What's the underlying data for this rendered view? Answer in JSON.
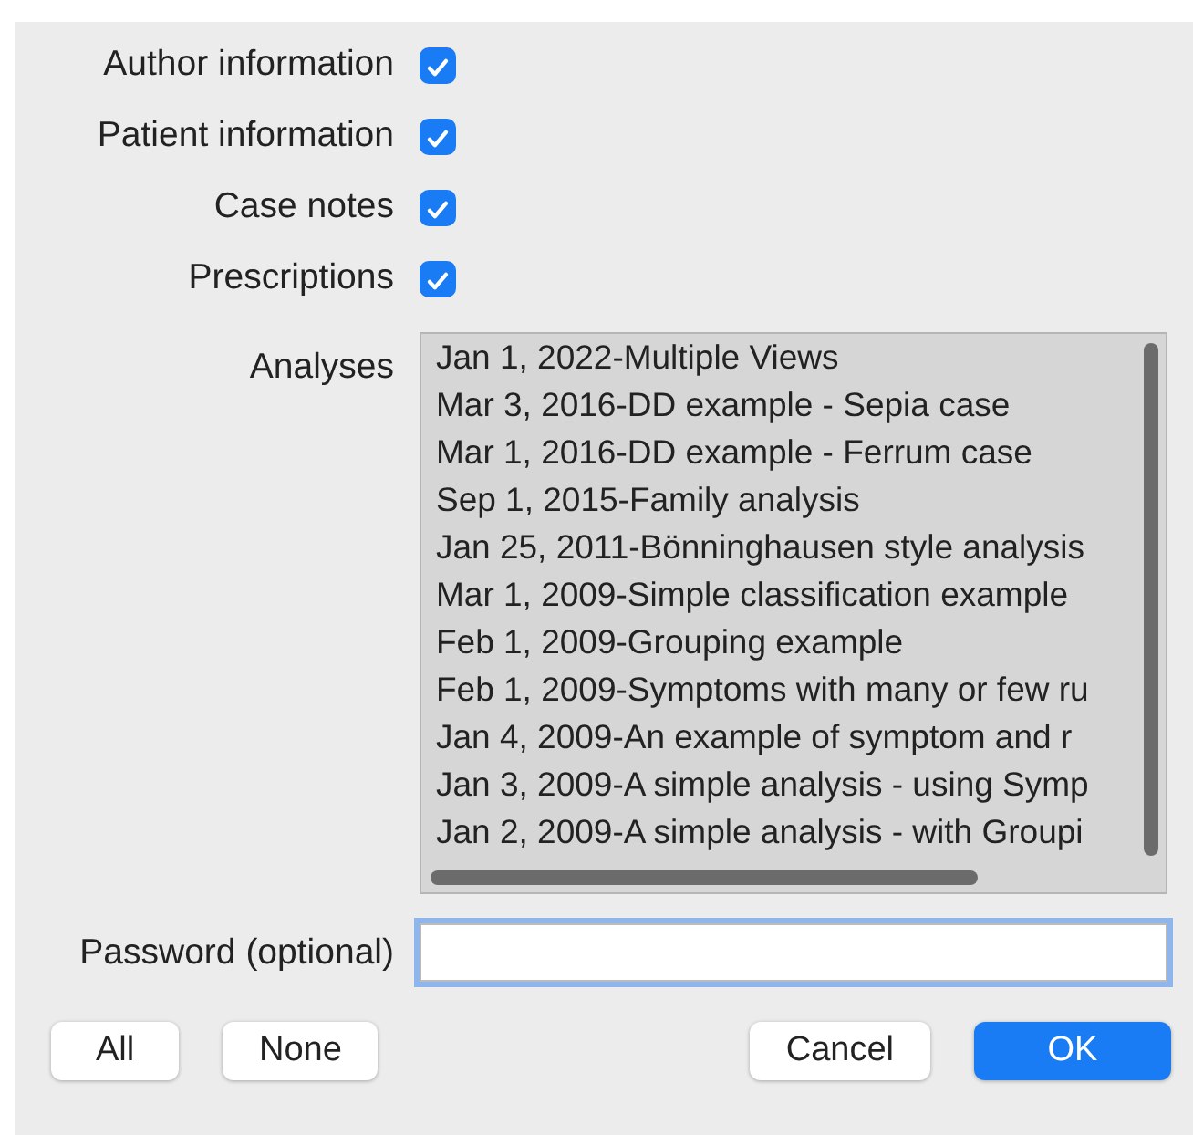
{
  "options": [
    {
      "label": "Author information",
      "checked": true
    },
    {
      "label": "Patient information",
      "checked": true
    },
    {
      "label": "Case notes",
      "checked": true
    },
    {
      "label": "Prescriptions",
      "checked": true
    }
  ],
  "analyses": {
    "label": "Analyses",
    "items": [
      {
        "text": "Jan 1, 2022-Multiple Views",
        "selected": true
      },
      {
        "text": "Mar 3, 2016-DD example - Sepia case",
        "selected": true
      },
      {
        "text": "Mar 1, 2016-DD example - Ferrum case",
        "selected": true
      },
      {
        "text": "Sep 1, 2015-Family analysis",
        "selected": true
      },
      {
        "text": "Jan 25, 2011-Bönninghausen style analysis",
        "selected": true
      },
      {
        "text": "Mar 1, 2009-Simple classification example",
        "selected": true
      },
      {
        "text": "Feb 1, 2009-Grouping example",
        "selected": true
      },
      {
        "text": "Feb 1, 2009-Symptoms with many or few ru",
        "selected": true
      },
      {
        "text": "Jan 4, 2009-An example of symptom and r",
        "selected": true
      },
      {
        "text": "Jan 3, 2009-A simple analysis - using Symp",
        "selected": true
      },
      {
        "text": "Jan 2, 2009-A simple analysis - with Groupi",
        "selected": true
      }
    ]
  },
  "password": {
    "label": "Password (optional)",
    "focused": true
  },
  "left_buttons": [
    {
      "label": "All",
      "kind": "plain"
    },
    {
      "label": "None",
      "kind": "plain"
    }
  ],
  "right_buttons": [
    {
      "label": "Cancel",
      "kind": "plain"
    },
    {
      "label": "OK",
      "kind": "default"
    }
  ]
}
